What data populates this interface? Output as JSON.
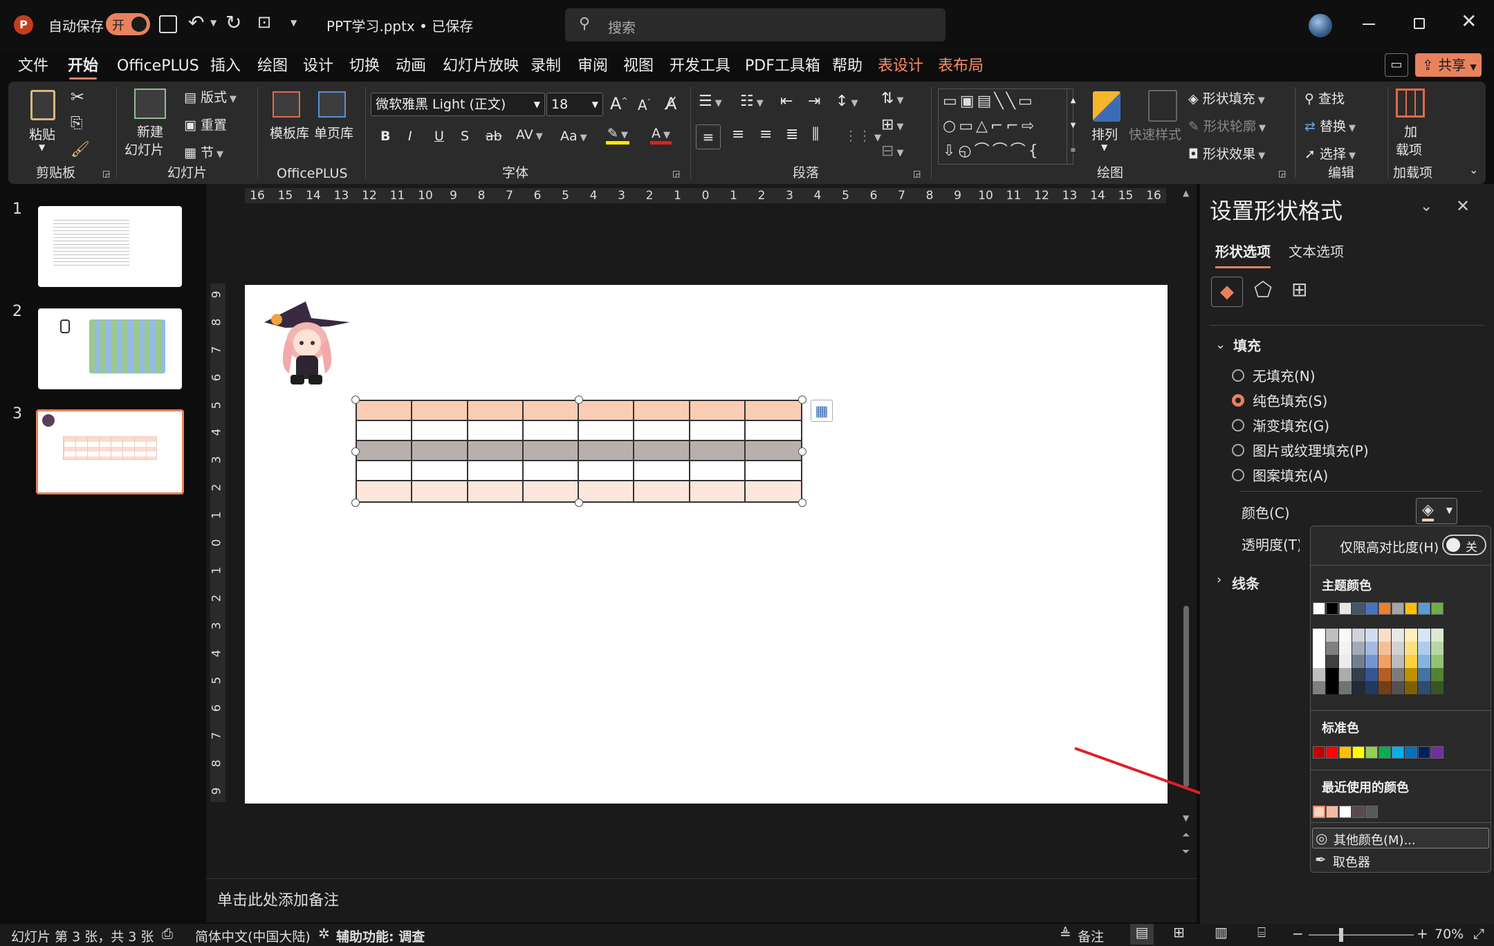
{
  "titlebar": {
    "autosave_label": "自动保存",
    "autosave_toggle": "开",
    "filename": "PPT学习.pptx • 已保存",
    "search_placeholder": "搜索"
  },
  "tabs": [
    "文件",
    "开始",
    "OfficePLUS",
    "插入",
    "绘图",
    "设计",
    "切换",
    "动画",
    "幻灯片放映",
    "录制",
    "审阅",
    "视图",
    "开发工具",
    "PDF工具箱",
    "帮助",
    "表设计",
    "表布局"
  ],
  "share_label": "共享",
  "ribbon": {
    "clipboard": {
      "paste": "粘贴",
      "group": "剪贴板"
    },
    "slides": {
      "new_slide_line1": "新建",
      "new_slide_line2": "幻灯片",
      "layout": "版式",
      "reset": "重置",
      "section": "节",
      "group": "幻灯片"
    },
    "officeplus": {
      "template": "模板库",
      "single": "单页库",
      "group": "OfficePLUS"
    },
    "font": {
      "name": "微软雅黑 Light (正文)",
      "size": "18",
      "bold": "B",
      "italic": "I",
      "underline": "U",
      "shadow": "S",
      "strike": "ab",
      "group": "字体"
    },
    "paragraph": {
      "group": "段落"
    },
    "drawing": {
      "arrange": "排列",
      "quick_styles": "快速样式",
      "shape_fill": "形状填充",
      "shape_outline": "形状轮廓",
      "shape_effects": "形状效果",
      "group": "绘图"
    },
    "editing": {
      "find": "查找",
      "replace": "替换",
      "select": "选择",
      "group": "编辑"
    },
    "addins": {
      "line1": "加",
      "line2": "载项",
      "group": "加载项"
    }
  },
  "slides": [
    "1",
    "2",
    "3"
  ],
  "ruler_h": [
    "16",
    "15",
    "14",
    "13",
    "12",
    "11",
    "10",
    "9",
    "8",
    "7",
    "6",
    "5",
    "4",
    "3",
    "2",
    "1",
    "0",
    "1",
    "2",
    "3",
    "4",
    "5",
    "6",
    "7",
    "8",
    "9",
    "10",
    "11",
    "12",
    "13",
    "14",
    "15",
    "16"
  ],
  "ruler_v": [
    "9",
    "8",
    "7",
    "6",
    "5",
    "4",
    "3",
    "2",
    "1",
    "0",
    "1",
    "2",
    "3",
    "4",
    "5",
    "6",
    "7",
    "8",
    "9"
  ],
  "notes_placeholder": "单击此处添加备注",
  "format_pane": {
    "title": "设置形状格式",
    "tab_shape": "形状选项",
    "tab_text": "文本选项",
    "fill_header": "填充",
    "fill_options": [
      "无填充(N)",
      "纯色填充(S)",
      "渐变填充(G)",
      "图片或纹理填充(P)",
      "图案填充(A)"
    ],
    "selected_fill": "纯色填充(S)",
    "color_label": "颜色(C)",
    "transparency_label": "透明度(T)",
    "line_header": "线条"
  },
  "color_popup": {
    "high_contrast": "仅限高对比度(H)",
    "toggle_state": "关",
    "theme_colors": "主题颜色",
    "standard_colors": "标准色",
    "recent_colors": "最近使用的颜色",
    "more_colors": "其他颜色(M)...",
    "eyedropper": "取色器",
    "theme_top": [
      "#ffffff",
      "#000000",
      "#e7e6e6",
      "#44546a",
      "#4472c4",
      "#ed7d31",
      "#a5a5a5",
      "#ffc000",
      "#5b9bd5",
      "#70ad47"
    ],
    "standard": [
      "#c00000",
      "#ff0000",
      "#ffc000",
      "#ffff00",
      "#92d050",
      "#00b050",
      "#00b0f0",
      "#0070c0",
      "#002060",
      "#7030a0"
    ],
    "recent": [
      "#fbd3c1",
      "#f4b9a4",
      "#ffffff",
      "#5a4a4a",
      "#595959"
    ]
  },
  "table": {
    "header_color": "#fccdb5",
    "band_color": "#b8b0ad",
    "last_color": "#fde6dc",
    "cols": 8,
    "rows": 5
  },
  "status": {
    "slide_info": "幻灯片 第 3 张，共 3 张",
    "language": "简体中文(中国大陆)",
    "accessibility": "辅助功能: 调查",
    "notes": "备注",
    "zoom": "70%"
  }
}
